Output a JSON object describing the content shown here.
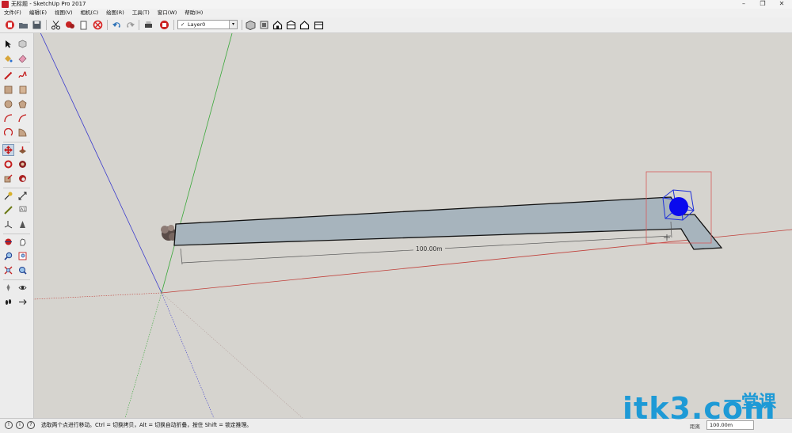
{
  "window": {
    "title": "无标题 - SketchUp Pro 2017",
    "controls": [
      "–",
      "❐",
      "✕"
    ]
  },
  "menu": [
    "文件(F)",
    "编辑(E)",
    "视图(V)",
    "相机(C)",
    "绘图(R)",
    "工具(T)",
    "窗口(W)",
    "帮助(H)"
  ],
  "toolbar": {
    "layer": {
      "check": "✓",
      "name": "Layer0",
      "arrow": "▾"
    }
  },
  "viewport": {
    "dimension_label": "100.00m",
    "colors": {
      "red_axis": "#c0403a",
      "green_axis": "#3aa83a",
      "blue_axis": "#3c3ccc",
      "face": "#a7b4bd",
      "sphere": "#0a0aee",
      "selection": "#d65a5a"
    }
  },
  "statusbar": {
    "icons": [
      "!",
      "i",
      "?"
    ],
    "hint": "选取两个点进行移动。Ctrl = 切换拷贝，Alt = 切换自动折叠，按住 Shift = 锁定推理。",
    "measure_label": "距离",
    "measure_value": "100.00m"
  },
  "watermark": {
    "latin": "itk3.com",
    "cjk": "一堂课"
  }
}
